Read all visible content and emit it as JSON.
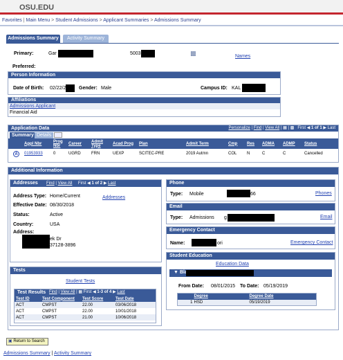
{
  "brand": "OSU.EDU",
  "breadcrumb": [
    "Favorites",
    "Main Menu",
    "Student Admissions",
    "Applicant Summaries",
    "Admissions Summary"
  ],
  "tabs": {
    "active": "Admissions Summary",
    "inactive": "Activity Summary"
  },
  "top": {
    "primary_label": "Primary:",
    "primary_value": "Gar",
    "id_partial": "5003",
    "names_link": "Names",
    "preferred_label": "Preferred:"
  },
  "person": {
    "title": "Person Information",
    "dob_label": "Date of Birth:",
    "dob_value": "02/22/2",
    "gender_label": "Gender:",
    "gender_value": "Male",
    "campus_label": "Campus ID:",
    "campus_value": "KAL"
  },
  "affiliations": {
    "title": "Affiliations",
    "items": [
      "Admissions Applicant",
      "Financial Aid"
    ]
  },
  "appdata": {
    "title": "Application Data",
    "personalize": "Personalize",
    "find": "Find",
    "viewall": "View All",
    "first": "First",
    "range": "1 of 1",
    "last": "Last",
    "subtabs": [
      "Summary",
      "Details"
    ],
    "columns": [
      "Appl Nbr",
      "Prog Nbr",
      "Career",
      "Admit Type",
      "Acad Prog",
      "Plan",
      "Admit Term",
      "Cmp",
      "Res",
      "ADMA",
      "ADMP",
      "Status"
    ],
    "row_marker": "A",
    "row": [
      "01953933",
      "0",
      "UGRD",
      "FRN",
      "UEXP",
      "SCITEC-PRE",
      "2019 Autmn",
      "COL",
      "N",
      "C",
      "C",
      "Cancelled"
    ]
  },
  "additional": {
    "title": "Additional Information"
  },
  "addresses": {
    "title": "Addresses",
    "find": "Find",
    "viewall": "View All",
    "first": "First",
    "range": "1 of 2",
    "last": "Last",
    "type_label": "Address Type:",
    "type_value": "Home/Current",
    "link": "Addresses",
    "eff_label": "Effective Date:",
    "eff_value": "08/30/2018",
    "status_label": "Status:",
    "status_value": "Active",
    "country_label": "Country:",
    "country_value": "USA",
    "address_label": "Address:",
    "line1": "ek Dr",
    "line2": "37128-3896"
  },
  "phone": {
    "title": "Phone",
    "type_label": "Type:",
    "type_value": "Mobile",
    "number_tail": "66",
    "link": "Phones"
  },
  "email": {
    "title": "Email",
    "type_label": "Type:",
    "type_value": "Admissions",
    "addr_head": "g",
    "link": "Email"
  },
  "emergency": {
    "title": "Emergency Contact",
    "name_label": "Name:",
    "name_tail": "ori",
    "link": "Emergency Contact"
  },
  "education": {
    "title": "Student Education",
    "link": "Education Data",
    "school": "Bla",
    "from_label": "From Date:",
    "from_value": "08/01/2015",
    "to_label": "To Date:",
    "to_value": "05/19/2019",
    "cols": [
      "Degree",
      "Degree Date"
    ],
    "rows": [
      [
        "1",
        "HSD",
        "05/19/2019"
      ]
    ]
  },
  "tests": {
    "title": "Tests",
    "link": "Student Tests",
    "results_title": "Test Results",
    "find": "Find",
    "viewall": "View All",
    "first": "First",
    "range": "1-3 of 4",
    "last": "Last",
    "cols": [
      "Test ID",
      "Test Component",
      "Test Score",
      "Test Date"
    ],
    "rows": [
      [
        "ACT",
        "CMPST",
        "22.00",
        "03/06/2018"
      ],
      [
        "ACT",
        "CMPST",
        "22.00",
        "10/01/2018"
      ],
      [
        "ACT",
        "CMPST",
        "21.00",
        "10/06/2018"
      ]
    ]
  },
  "footer": {
    "return_button": "Return to Search",
    "link1": "Admissions Summary",
    "sep": "|",
    "link2": "Activity Summary"
  }
}
